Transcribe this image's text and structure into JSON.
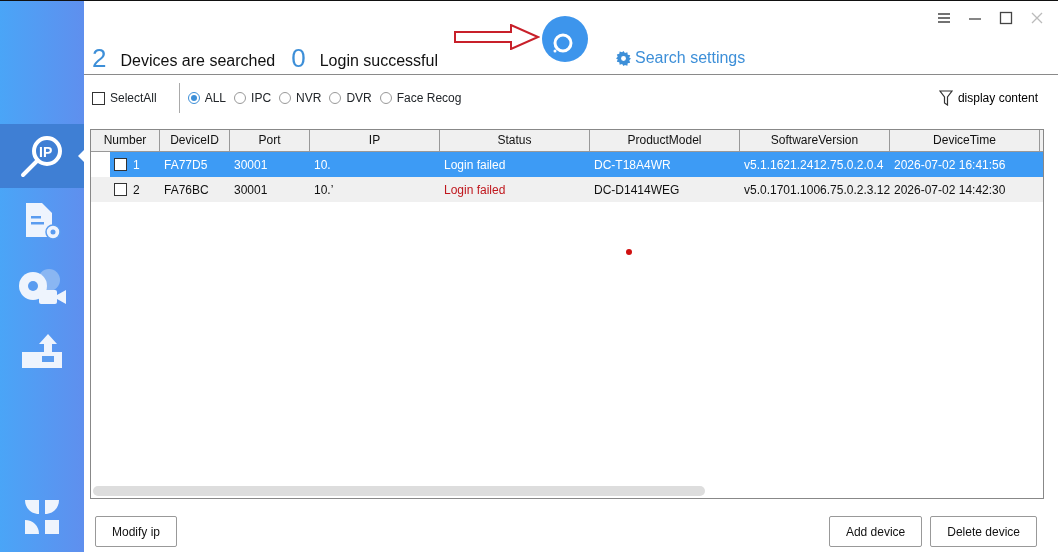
{
  "sidebar": {
    "items": [
      {
        "kind": "ip-search",
        "selected": true,
        "icon_text": "IP"
      },
      {
        "kind": "document-settings",
        "selected": false
      },
      {
        "kind": "camera-settings",
        "selected": false
      },
      {
        "kind": "upload",
        "selected": false
      }
    ]
  },
  "header": {
    "device_count": "2",
    "device_label": "Devices are searched",
    "login_count": "0",
    "login_label": "Login successful",
    "search_settings": "Search settings"
  },
  "filters": {
    "select_all": {
      "label": "SelectAll",
      "checked": false
    },
    "types": [
      {
        "label": "ALL",
        "selected": true
      },
      {
        "label": "IPC",
        "selected": false
      },
      {
        "label": "NVR",
        "selected": false
      },
      {
        "label": "DVR",
        "selected": false
      },
      {
        "label": "Face Recog",
        "selected": false
      }
    ],
    "display_content": "display content"
  },
  "table": {
    "columns": [
      "Number",
      "DeviceID",
      "Port",
      "IP",
      "Status",
      "ProductModel",
      "SoftwareVersion",
      "DeviceTime"
    ],
    "rows": [
      {
        "selected": true,
        "checked": false,
        "cells": [
          "1",
          "FA77D5",
          "30001",
          "10.",
          "Login failed",
          "DC-T18A4WR",
          "v5.1.1621.2412.75.0.2.0.4",
          "2026-07-02 16:41:56"
        ]
      },
      {
        "selected": false,
        "checked": false,
        "cells": [
          "2",
          "FA76BC",
          "30001",
          "10.’",
          "Login failed",
          "DC-D1414WEG",
          "v5.0.1701.1006.75.0.2.3.12",
          "2026-07-02 14:42:30"
        ]
      }
    ]
  },
  "buttons": {
    "left": [
      "Modify ip"
    ],
    "right": [
      "Add device",
      "Delete device"
    ]
  }
}
